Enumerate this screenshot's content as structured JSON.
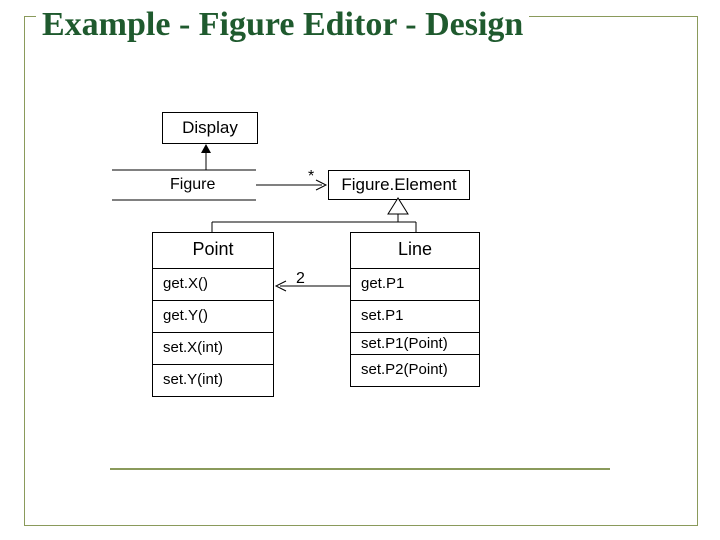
{
  "title": "Example - Figure Editor - Design",
  "display_box": "Display",
  "figure_box": "Figure",
  "fe_box": "Figure.Element",
  "assoc_mult": "*",
  "link_mult": "2",
  "point": {
    "name": "Point",
    "m1": "get.X()",
    "m2": "get.Y()",
    "m3": "set.X(int)",
    "m4": "set.Y(int)"
  },
  "line": {
    "name": "Line",
    "m1": "get.P1",
    "m2": "set.P1",
    "m3": "set.P1(Point)",
    "m4": "set.P2(Point)"
  }
}
